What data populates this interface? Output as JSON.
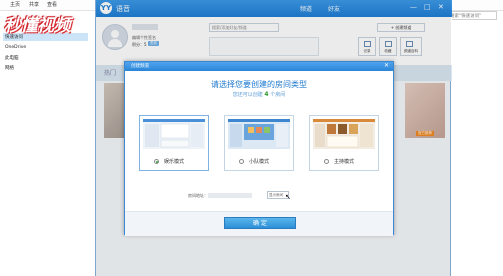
{
  "explorer": {
    "ribbon_tabs": [
      "主页",
      "共享",
      "查看"
    ],
    "search_placeholder": "搜索\"快速访问\"",
    "nav_items": [
      "快速访问",
      "OneDrive",
      "此电脑",
      "网络"
    ]
  },
  "watermark": "秒懂视频",
  "yy": {
    "logo": "YY",
    "app_name": "语音",
    "tabs": [
      "频道",
      "好友"
    ],
    "controls": [
      "—",
      "□",
      "✕"
    ],
    "signature": "编辑个性签名",
    "points_label": "积分：5",
    "points_badge": "签到",
    "search_placeholder": "搜索/添加好友/频道",
    "add_button": "+ 创建频道",
    "quick_buttons": [
      "记录",
      "收藏",
      "频道百科"
    ],
    "channel_label": "热门",
    "side_tag": "官方推荐"
  },
  "dialog": {
    "title": "创建频道",
    "close": "✕",
    "headline": "请选择您要创建的房间类型",
    "sub_prefix": "您还可以创建",
    "sub_count": "4",
    "sub_suffix": "个房间",
    "modes": [
      {
        "label": "娱乐模式",
        "selected": true
      },
      {
        "label": "小队模式",
        "selected": false
      },
      {
        "label": "主持模式",
        "selected": false
      }
    ],
    "address_label": "房间地址：",
    "address_field": "显示房间",
    "confirm": "确 定"
  }
}
